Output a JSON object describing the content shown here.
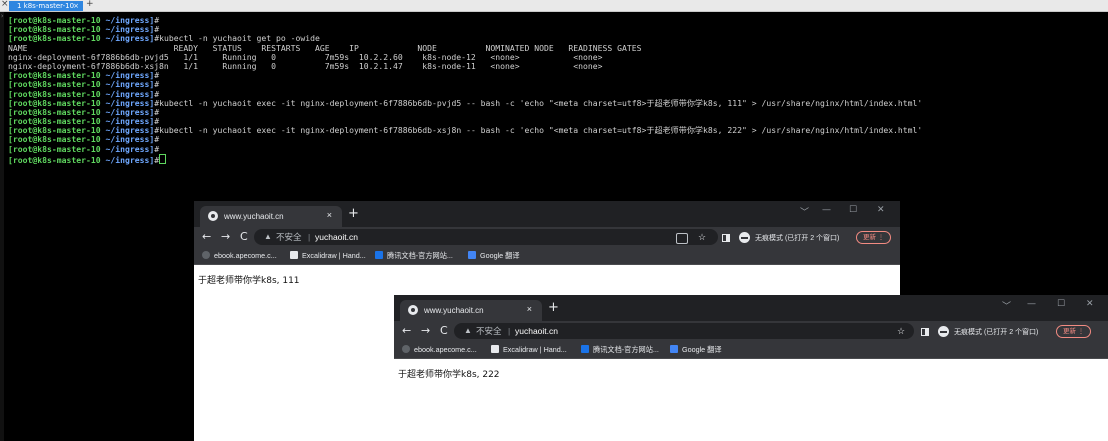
{
  "terminal_tabs": {
    "close_symbol": "×",
    "active_tab": {
      "label": "1 k8s-master-10",
      "close": "×"
    },
    "add": "+"
  },
  "terminal": {
    "lines": [
      {
        "user": "[root@k8s-master-10",
        "path": " ~/ingress]",
        "hash": "#",
        "cmd": ""
      },
      {
        "user": "[root@k8s-master-10",
        "path": " ~/ingress]",
        "hash": "#",
        "cmd": ""
      },
      {
        "user": "[root@k8s-master-10",
        "path": " ~/ingress]",
        "hash": "#",
        "cmd": "kubectl -n yuchaoit get po -owide"
      },
      {
        "text": "NAME                              READY   STATUS    RESTARTS   AGE    IP            NODE          NOMINATED NODE   READINESS GATES"
      },
      {
        "text": "nginx-deployment-6f7886b6db-pvjd5   1/1     Running   0          7m59s  10.2.2.60    k8s-node-12   <none>           <none>"
      },
      {
        "text": "nginx-deployment-6f7886b6db-xsj8n   1/1     Running   0          7m59s  10.2.1.47    k8s-node-11   <none>           <none>"
      },
      {
        "user": "[root@k8s-master-10",
        "path": " ~/ingress]",
        "hash": "#",
        "cmd": ""
      },
      {
        "user": "[root@k8s-master-10",
        "path": " ~/ingress]",
        "hash": "#",
        "cmd": ""
      },
      {
        "user": "[root@k8s-master-10",
        "path": " ~/ingress]",
        "hash": "#",
        "cmd": ""
      },
      {
        "user": "[root@k8s-master-10",
        "path": " ~/ingress]",
        "hash": "#",
        "cmd": "kubectl -n yuchaoit exec -it nginx-deployment-6f7886b6db-pvjd5 -- bash -c 'echo \"<meta charset=utf8>于超老师带你学k8s, 111\" > /usr/share/nginx/html/index.html'"
      },
      {
        "user": "[root@k8s-master-10",
        "path": " ~/ingress]",
        "hash": "#",
        "cmd": ""
      },
      {
        "user": "[root@k8s-master-10",
        "path": " ~/ingress]",
        "hash": "#",
        "cmd": ""
      },
      {
        "user": "[root@k8s-master-10",
        "path": " ~/ingress]",
        "hash": "#",
        "cmd": "kubectl -n yuchaoit exec -it nginx-deployment-6f7886b6db-xsj8n -- bash -c 'echo \"<meta charset=utf8>于超老师带你学k8s, 222\" > /usr/share/nginx/html/index.html'"
      },
      {
        "user": "[root@k8s-master-10",
        "path": " ~/ingress]",
        "hash": "#",
        "cmd": ""
      },
      {
        "user": "[root@k8s-master-10",
        "path": " ~/ingress]",
        "hash": "#",
        "cmd": ""
      },
      {
        "user": "[root@k8s-master-10",
        "path": " ~/ingress]",
        "hash": "#",
        "cmd": "",
        "cursor": true
      }
    ]
  },
  "browser1": {
    "tab_title": "www.yuchaoit.cn",
    "tab_close": "×",
    "new_tab": "+",
    "window_controls": {
      "chevron": "﹀",
      "minimize": "—",
      "maximize": "☐",
      "close": "✕"
    },
    "nav": {
      "back": "←",
      "forward": "→",
      "reload": "C"
    },
    "address": {
      "warn": "▲",
      "insecure": "不安全",
      "sep": "|",
      "url": "yuchaoit.cn",
      "star": "☆"
    },
    "incognito_label": "无痕模式 (已打开 2 个窗口)",
    "update_label": "更新  ⋮",
    "bookmarks": [
      "ebook.apecome.c...",
      "Excalidraw | Hand...",
      "腾讯文档-官方网站...",
      "Google 翻译"
    ],
    "content": "于超老师带你学k8s, 111"
  },
  "browser2": {
    "tab_title": "www.yuchaoit.cn",
    "tab_close": "×",
    "new_tab": "+",
    "window_controls": {
      "chevron": "﹀",
      "minimize": "—",
      "maximize": "☐",
      "close": "✕"
    },
    "nav": {
      "back": "←",
      "forward": "→",
      "reload": "C"
    },
    "address": {
      "warn": "▲",
      "insecure": "不安全",
      "sep": "|",
      "url": "yuchaoit.cn",
      "star": "☆"
    },
    "incognito_label": "无痕模式 (已打开 2 个窗口)",
    "update_label": "更新  ⋮",
    "bookmarks": [
      "ebook.apecome.c...",
      "Excalidraw | Hand...",
      "腾讯文档-官方网站...",
      "Google 翻译"
    ],
    "content": "于超老师带你学k8s, 222"
  }
}
